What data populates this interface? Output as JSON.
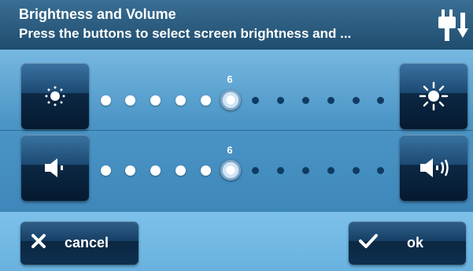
{
  "header": {
    "title": "Brightness and Volume",
    "subtitle": "Press the buttons to select screen brightness and ..."
  },
  "brightness": {
    "value": "6",
    "level": 6,
    "max": 12,
    "decrease_icon": "brightness-low-icon",
    "increase_icon": "brightness-high-icon"
  },
  "volume": {
    "value": "6",
    "level": 6,
    "max": 12,
    "decrease_icon": "volume-low-icon",
    "increase_icon": "volume-high-icon"
  },
  "footer": {
    "cancel_label": "cancel",
    "ok_label": "ok"
  },
  "colors": {
    "header": "#1f4d6e",
    "panel": "#4b95c6",
    "footer": "#7cc1ea",
    "button": "#0b2742"
  }
}
